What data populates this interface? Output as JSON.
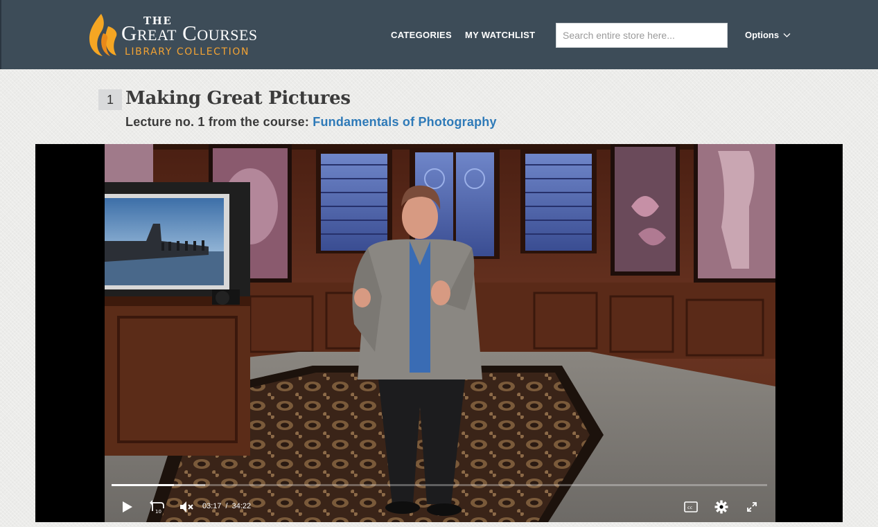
{
  "header": {
    "logo": {
      "the": "THE",
      "name": "Great Courses",
      "sub": "LIBRARY COLLECTION"
    },
    "nav": {
      "categories": "CATEGORIES",
      "watchlist": "MY WATCHLIST",
      "options": "Options"
    },
    "search": {
      "placeholder": "Search entire store here..."
    }
  },
  "lecture": {
    "number": "1",
    "title": "Making Great Pictures",
    "subtitle_prefix": "Lecture no. 1 from the course:",
    "course_name": "Fundamentals of Photography"
  },
  "player": {
    "current_time": "03:17",
    "time_separator": "/",
    "duration": "34:22",
    "progress_fraction": 0.0955,
    "buffered_fraction": 0.143,
    "icons": {
      "play": "play-icon",
      "rewind": "rewind-10-icon",
      "mute": "volume-muted-icon",
      "captions": "closed-captions-icon",
      "settings": "gear-icon",
      "fullscreen": "fullscreen-icon"
    }
  },
  "colors": {
    "header_bg": "#3d4c58",
    "accent_orange": "#f3a333",
    "link_blue": "#2e7ab8"
  }
}
